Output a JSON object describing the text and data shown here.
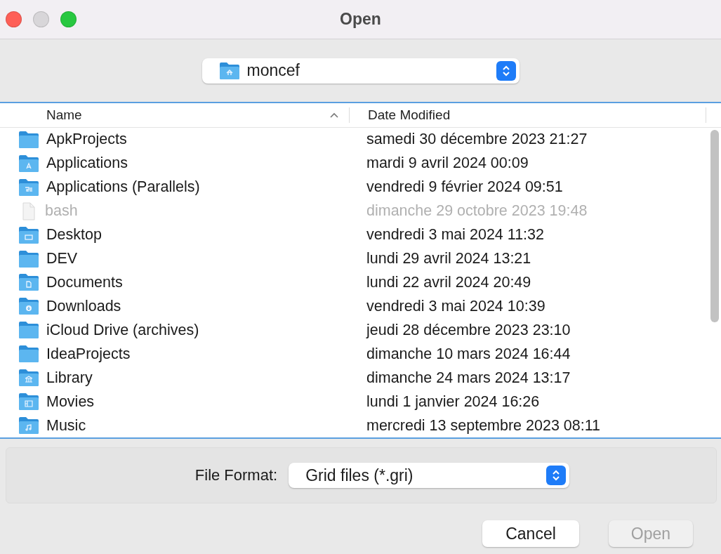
{
  "window": {
    "title": "Open"
  },
  "location": {
    "value": "moncef"
  },
  "table": {
    "columns": [
      {
        "label": "Name",
        "sorted": true
      },
      {
        "label": "Date Modified",
        "sorted": false
      }
    ],
    "rows": [
      {
        "name": "ApkProjects",
        "date": "samedi 30 décembre 2023 21:27",
        "kind": "folder",
        "disabled": false
      },
      {
        "name": "Applications",
        "date": "mardi 9 avril 2024 00:09",
        "kind": "apps",
        "disabled": false
      },
      {
        "name": "Applications (Parallels)",
        "date": "vendredi 9 février 2024 09:51",
        "kind": "parallels",
        "disabled": false
      },
      {
        "name": "bash",
        "date": "dimanche 29 octobre 2023 19:48",
        "kind": "file",
        "disabled": true
      },
      {
        "name": "Desktop",
        "date": "vendredi 3 mai 2024 11:32",
        "kind": "desktop",
        "disabled": false
      },
      {
        "name": "DEV",
        "date": "lundi 29 avril 2024 13:21",
        "kind": "folder",
        "disabled": false
      },
      {
        "name": "Documents",
        "date": "lundi 22 avril 2024 20:49",
        "kind": "documents",
        "disabled": false
      },
      {
        "name": "Downloads",
        "date": "vendredi 3 mai 2024 10:39",
        "kind": "downloads",
        "disabled": false
      },
      {
        "name": "iCloud Drive (archives)",
        "date": "jeudi 28 décembre 2023 23:10",
        "kind": "folder",
        "disabled": false
      },
      {
        "name": "IdeaProjects",
        "date": "dimanche 10 mars 2024 16:44",
        "kind": "folder",
        "disabled": false
      },
      {
        "name": "Library",
        "date": "dimanche 24 mars 2024 13:17",
        "kind": "library",
        "disabled": false
      },
      {
        "name": "Movies",
        "date": "lundi 1 janvier 2024 16:26",
        "kind": "movies",
        "disabled": false
      },
      {
        "name": "Music",
        "date": "mercredi 13 septembre 2023 08:11",
        "kind": "music",
        "disabled": false
      }
    ]
  },
  "format": {
    "label": "File Format:",
    "value": "Grid files (*.gri)"
  },
  "buttons": [
    {
      "label": "Cancel",
      "disabled": false
    },
    {
      "label": "Open",
      "disabled": true
    }
  ]
}
